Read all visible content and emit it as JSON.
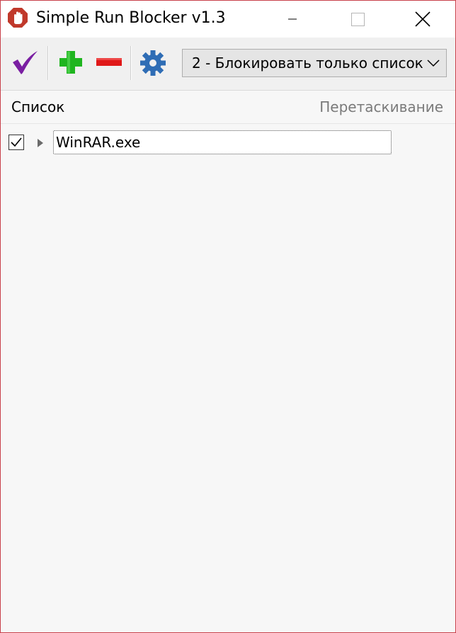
{
  "window": {
    "title": "Simple Run Blocker v1.3",
    "accent_border": "#c8414b"
  },
  "toolbar": {
    "apply_icon": "checkmark-icon",
    "add_icon": "plus-icon",
    "remove_icon": "minus-icon",
    "settings_icon": "gear-icon",
    "mode_selected": "2 - Блокировать только список"
  },
  "list": {
    "columns": [
      "Список",
      "Перетаскивание"
    ],
    "items": [
      {
        "label": "WinRAR.exe",
        "checked": true
      }
    ]
  },
  "colors": {
    "check": "#7a1fa2",
    "plus": "#1fb51f",
    "minus": "#e01818",
    "gear": "#2f6db5",
    "app_icon": "#c0392b"
  }
}
